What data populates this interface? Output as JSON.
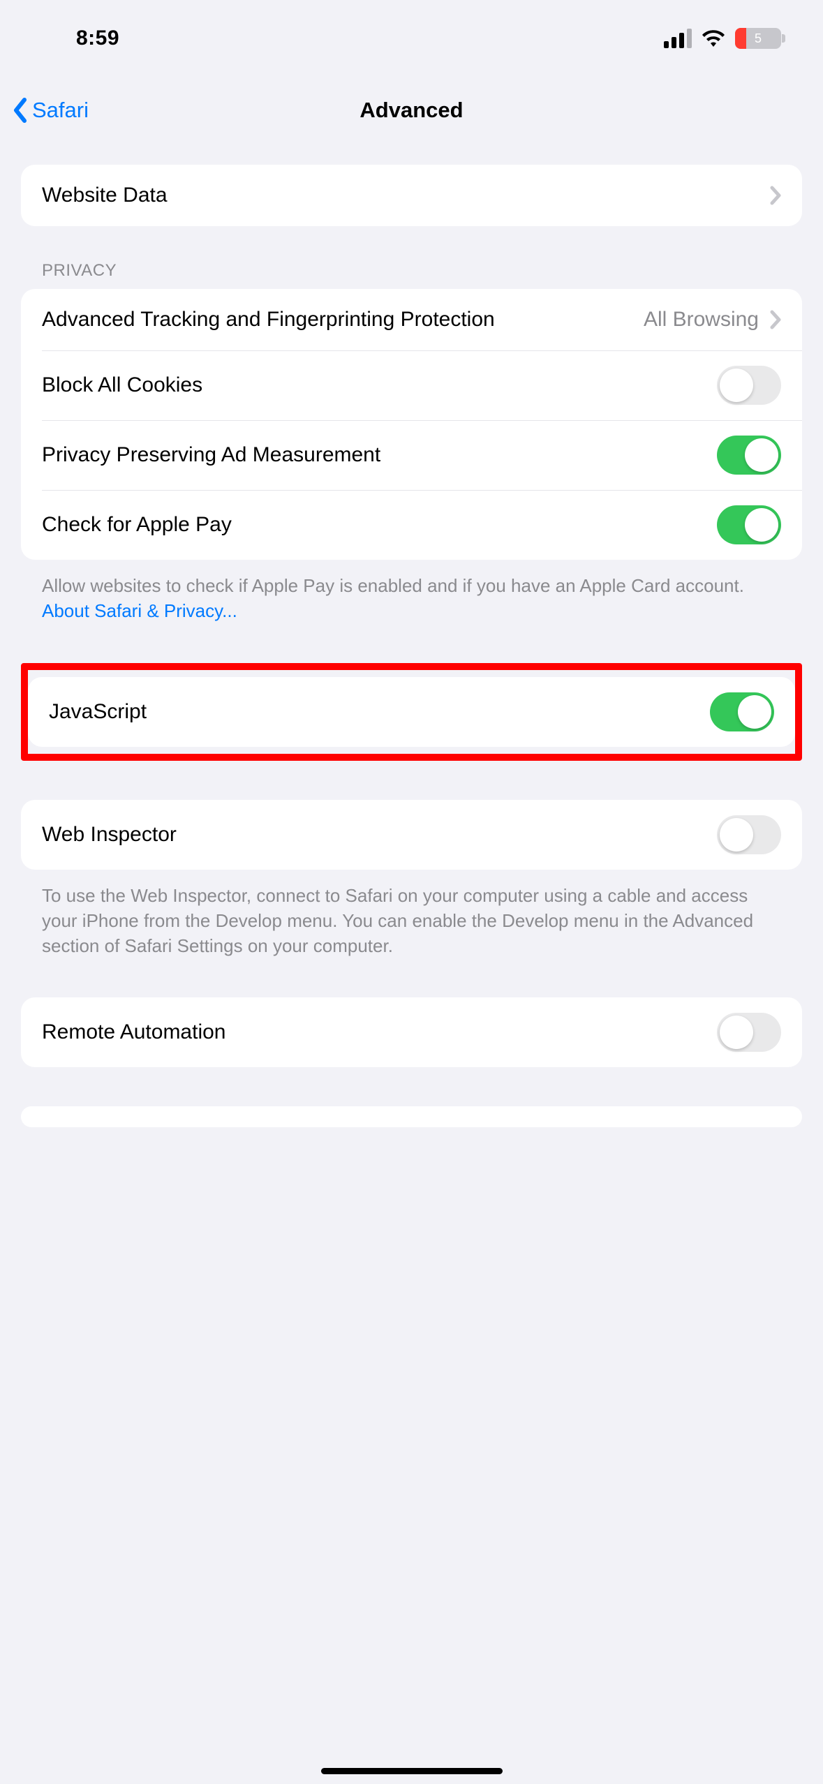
{
  "status": {
    "time": "8:59",
    "battery_level": "5"
  },
  "nav": {
    "back_label": "Safari",
    "title": "Advanced"
  },
  "rows": {
    "website_data": "Website Data"
  },
  "privacy": {
    "header": "PRIVACY",
    "tracking_label": "Advanced Tracking and Fingerprinting Protection",
    "tracking_value": "All Browsing",
    "block_cookies": "Block All Cookies",
    "ppam": "Privacy Preserving Ad Measurement",
    "apple_pay": "Check for Apple Pay",
    "footer": "Allow websites to check if Apple Pay is enabled and if you have an Apple Card account.",
    "link": "About Safari & Privacy..."
  },
  "javascript": {
    "label": "JavaScript"
  },
  "web_inspector": {
    "label": "Web Inspector",
    "footer": "To use the Web Inspector, connect to Safari on your computer using a cable and access your iPhone from the Develop menu. You can enable the Develop menu in the Advanced section of Safari Settings on your computer."
  },
  "remote_automation": {
    "label": "Remote Automation"
  },
  "toggles": {
    "block_cookies": false,
    "ppam": true,
    "apple_pay": true,
    "javascript": true,
    "web_inspector": false,
    "remote_automation": false
  }
}
